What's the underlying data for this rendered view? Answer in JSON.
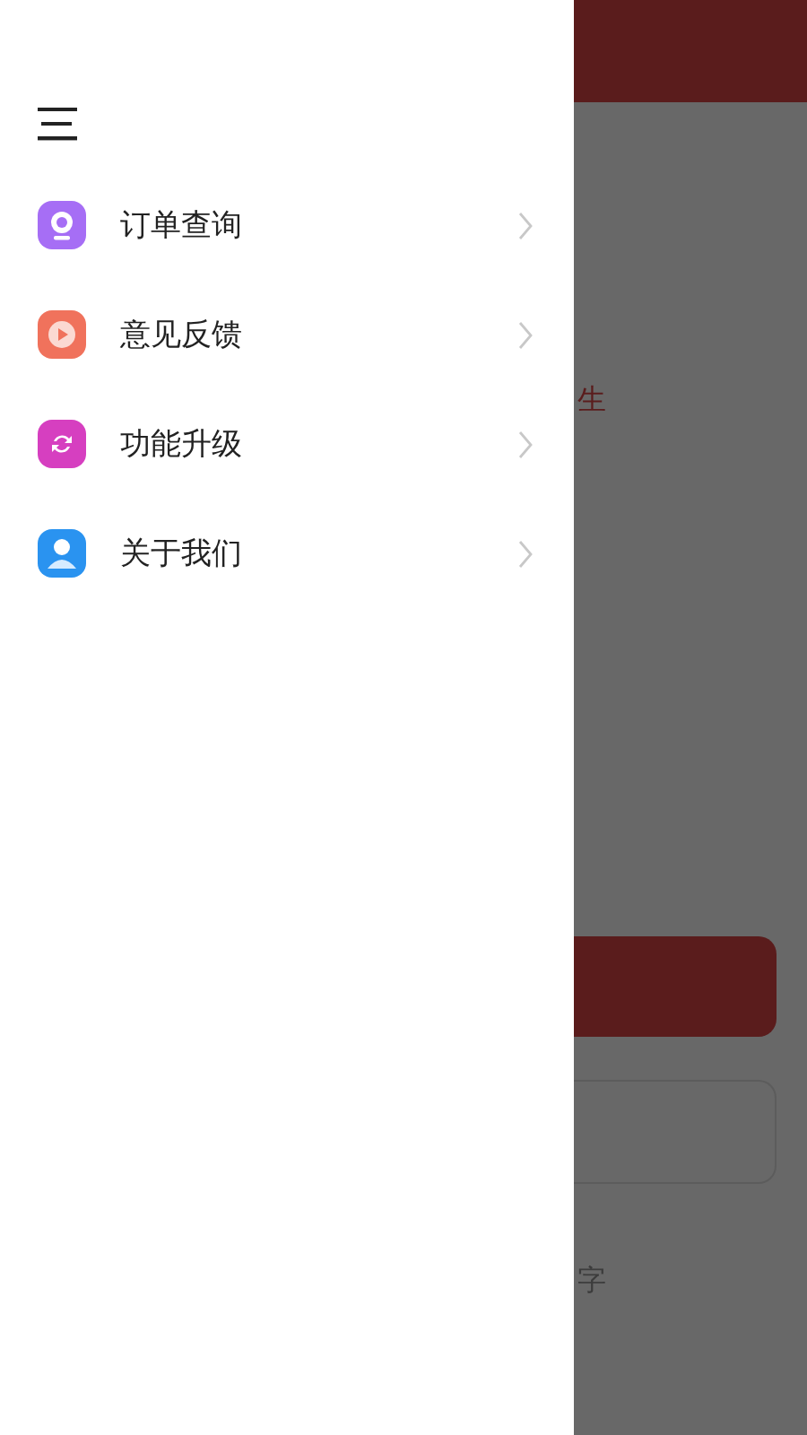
{
  "drawer": {
    "menu_items": [
      {
        "label": "订单查询",
        "kind": "camera",
        "color": "#a66ef5"
      },
      {
        "label": "意见反馈",
        "kind": "play",
        "color": "#f0725c"
      },
      {
        "label": "功能升级",
        "kind": "refresh",
        "color": "#d63fc0"
      },
      {
        "label": "关于我们",
        "kind": "person",
        "color": "#2a93f0"
      }
    ]
  },
  "background_page": {
    "texts": [
      {
        "label": "生",
        "kind": "accent"
      },
      {
        "label": "字",
        "kind": "muted"
      }
    ]
  }
}
